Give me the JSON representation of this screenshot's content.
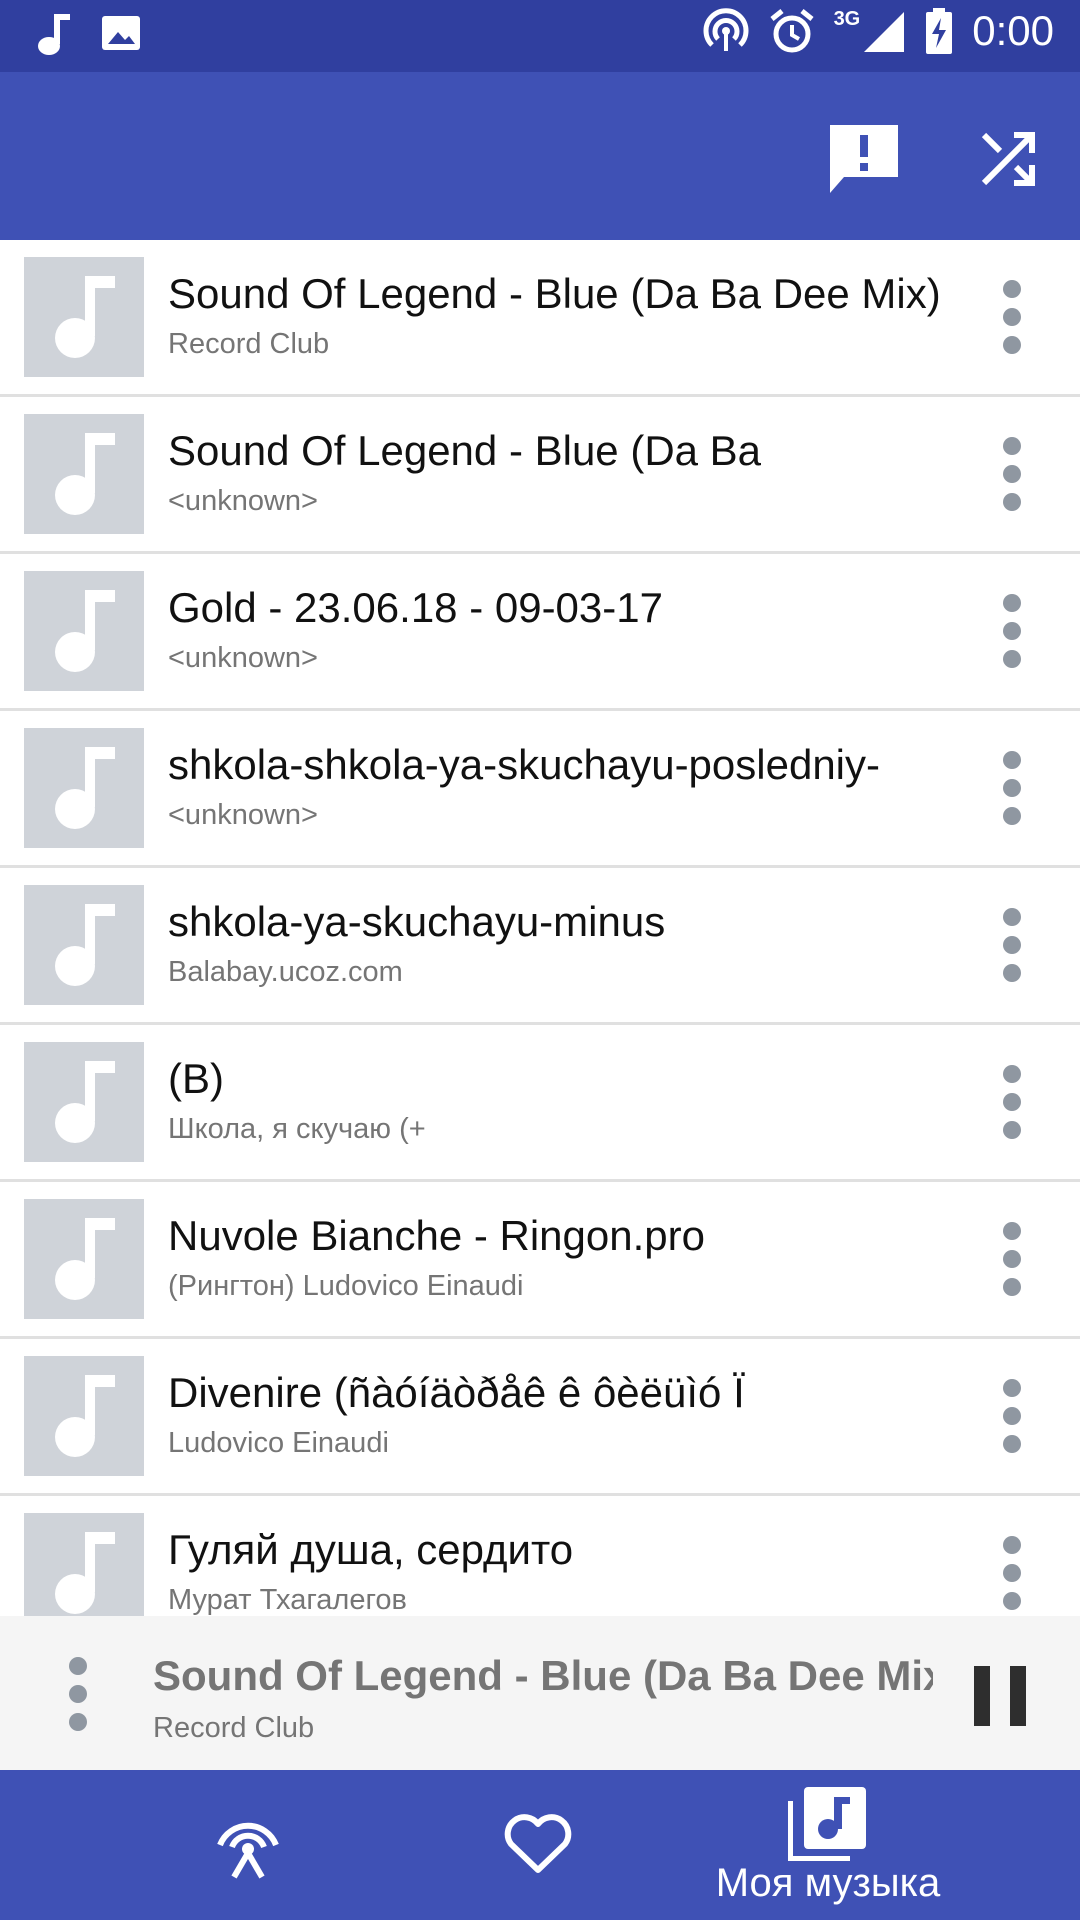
{
  "status_bar": {
    "time": "0:00",
    "network": "3G",
    "left_icons": [
      "music-note-icon",
      "image-icon"
    ],
    "right_icons": [
      "hotspot-icon",
      "alarm-icon",
      "signal-icon",
      "battery-charging-icon"
    ]
  },
  "toolbar": {
    "actions": [
      "feedback-icon",
      "shuffle-icon"
    ],
    "color": "#3f51b5"
  },
  "tracks": [
    {
      "title": "Sound Of Legend - Blue (Da Ba Dee Mix)",
      "artist": "Record Club"
    },
    {
      "title": "Sound Of Legend - Blue (Da Ba",
      "artist": "<unknown>"
    },
    {
      "title": "Gold - 23.06.18 - 09-03-17",
      "artist": "<unknown>"
    },
    {
      "title": "shkola-shkola-ya-skuchayu-posledniy-",
      "artist": "<unknown>"
    },
    {
      "title": "shkola-ya-skuchayu-minus",
      "artist": "Balabay.ucoz.com"
    },
    {
      "title": "(B)",
      "artist": "Школа, я скучаю (+"
    },
    {
      "title": "Nuvole Bianche - Ringon.pro",
      "artist": "(Рингтон) Ludovico Einaudi"
    },
    {
      "title": "Divenire (ñàóíäòðåê ê ôèëüìó Ï",
      "artist": "Ludovico Einaudi"
    },
    {
      "title": "Гуляй душа, сердито",
      "artist": "Мурат Тхагалегов"
    }
  ],
  "now_playing": {
    "title": "Sound Of Legend - Blue (Da Ba Dee Mix..",
    "artist": "Record Club",
    "state": "playing"
  },
  "bottom_nav": {
    "items": [
      {
        "icon": "radio-icon",
        "label": ""
      },
      {
        "icon": "heart-icon",
        "label": ""
      },
      {
        "icon": "my-music-icon",
        "label": "Моя музыка"
      }
    ],
    "active_index": 2
  },
  "colors": {
    "primary": "#3f51b5",
    "primary_dark": "#303f9f",
    "thumb_bg": "#cfd3d9",
    "secondary_text": "#757575"
  }
}
